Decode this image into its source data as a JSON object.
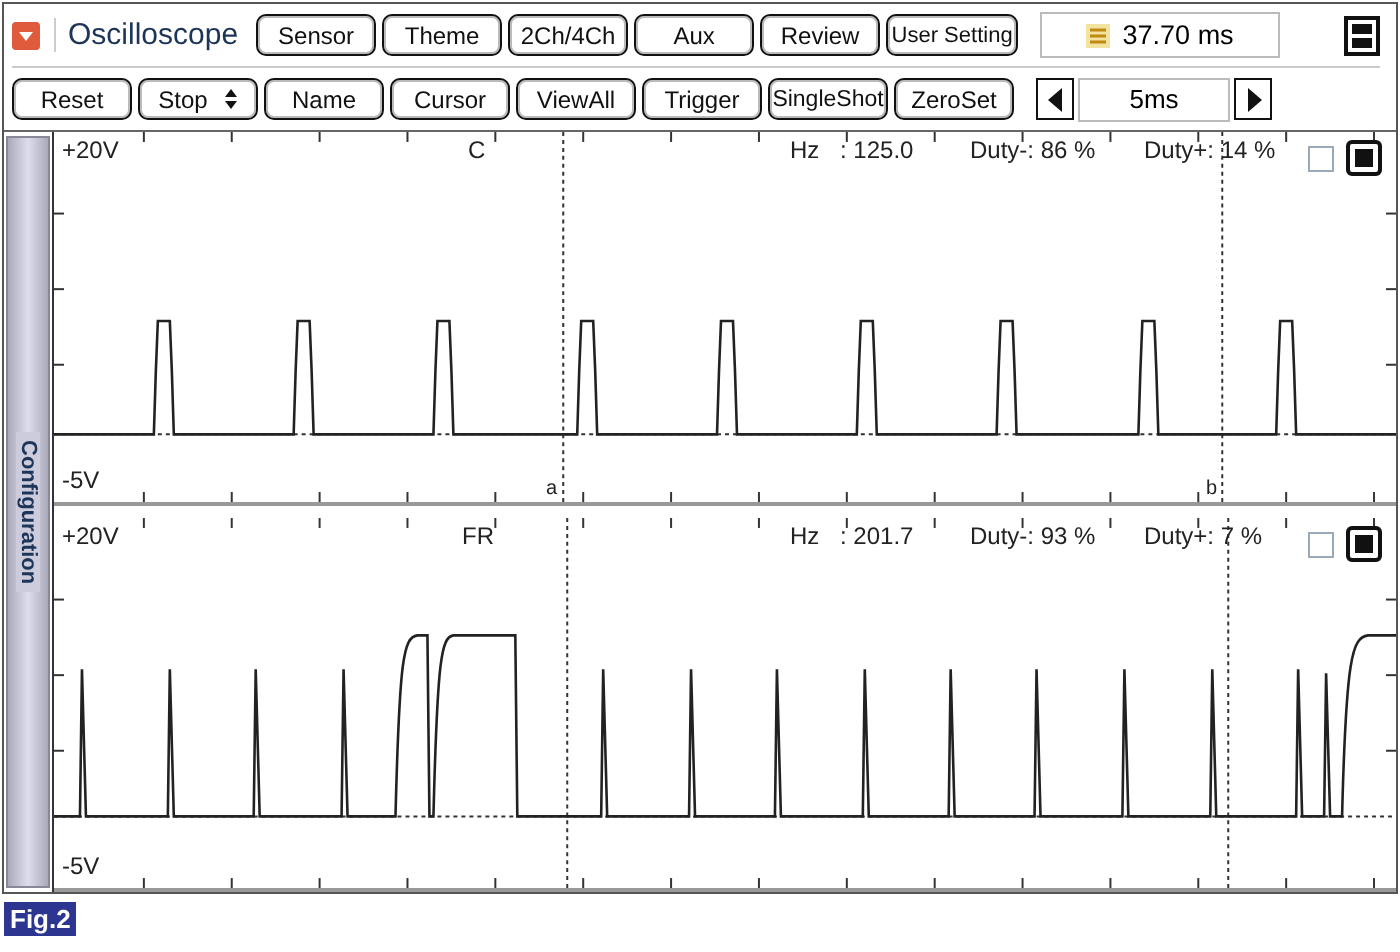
{
  "app_title": "Oscilloscope",
  "top_buttons": [
    "Sensor",
    "Theme",
    "2Ch/4Ch",
    "Aux",
    "Review",
    "User Setting"
  ],
  "time_readout": "37.70 ms",
  "controls": [
    {
      "label": "Reset",
      "kind": "button"
    },
    {
      "label": "Stop",
      "kind": "spinner"
    },
    {
      "label": "Name",
      "kind": "button"
    },
    {
      "label": "Cursor",
      "kind": "button"
    },
    {
      "label": "ViewAll",
      "kind": "button"
    },
    {
      "label": "Trigger",
      "kind": "button"
    },
    {
      "label": "SingleShot",
      "kind": "button"
    },
    {
      "label": "ZeroSet",
      "kind": "button"
    }
  ],
  "timebase": "5ms",
  "side_tab": "Configuration",
  "channels": [
    {
      "name": "C",
      "top_scale": "+20V",
      "bottom_scale": "-5V",
      "hz_label": "Hz",
      "hz_value": ": 125.0",
      "duty_minus": "Duty-: 86 %",
      "duty_plus": "Duty+: 14 %",
      "cursor_labels": [
        "a",
        "b"
      ]
    },
    {
      "name": "FR",
      "top_scale": "+20V",
      "bottom_scale": "-5V",
      "hz_label": "Hz",
      "hz_value": ": 201.7",
      "duty_minus": "Duty-: 93 %",
      "duty_plus": "Duty+: 7 %"
    }
  ],
  "figure_label": "Fig.2"
}
